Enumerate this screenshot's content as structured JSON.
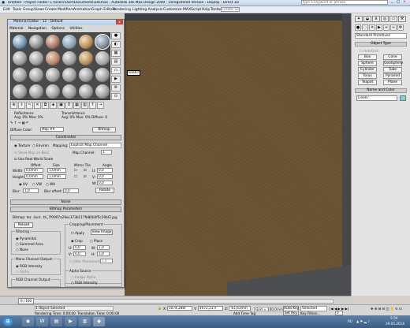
{
  "window": {
    "title": "Untitled     - Project Folder: C:\\Users\\User\\Documents\\3dsmax     - Autodesk 3ds Max Design 2009   - Unregistered Version      - Display : Direct 3D",
    "search_placeholder": "Type a keyword or phrase",
    "selection_set_placeholder": "Create Selection Set"
  },
  "menu": [
    "Edit",
    "Tools",
    "Group",
    "Views",
    "Create",
    "Modifiers",
    "Animation",
    "Graph Editors",
    "Rendering",
    "Lighting Analysis",
    "Customize",
    "MAXScript",
    "Help",
    "Tentacles"
  ],
  "viewport": {
    "object_label": "line07"
  },
  "command_panel": {
    "category_dropdown": "Standard Primitives",
    "object_type_header": "Object Type",
    "autogrid_label": "AutoGrid",
    "buttons": [
      "Box",
      "Cone",
      "Sphere",
      "GeoSphere",
      "Cylinder",
      "Tube",
      "Torus",
      "Pyramid",
      "Teapot",
      "Plane"
    ],
    "name_color_header": "Name and Color",
    "object_name": "Line07"
  },
  "material_editor": {
    "title": "Material Editor - 12 - Default",
    "menu": [
      "Material",
      "Navigation",
      "Options",
      "Utilities"
    ],
    "reflectance": {
      "label": "Reflectance",
      "avg": "Avg:",
      "avg_value": "0%",
      "max": "Max:",
      "max_value": "0%"
    },
    "transmittance": {
      "label": "Transmittance",
      "avg": "Avg:",
      "avg_value": "0%",
      "max": "Max:",
      "max_value": "0%",
      "diffuse": "Diffuse:",
      "diffuse_value": "0"
    },
    "map_label": "Diffuse Color:",
    "map_value": "Map #9",
    "bitmap_type": "Bitmap",
    "coordinates_header": "Coordinates",
    "texture_label": "Texture",
    "environ_label": "Environ",
    "mapping_label": "Mapping:",
    "mapping_value": "Explicit Map Channel",
    "show_map_on_back": "Show Map on Back",
    "map_channel_label": "Map Channel:",
    "map_channel_value": "1",
    "use_real_world_scale": "Use Real-World Scale",
    "col_offset": "Offset",
    "col_size": "Size",
    "col_mirror_tile": "Mirror Tile",
    "col_angle": "Angle",
    "width_label": "Width:",
    "width_offset": "0,0mm",
    "width_size": "1,0mm",
    "height_label": "Height:",
    "height_offset": "0,0mm",
    "height_size": "1,0mm",
    "u_angle_label": "U:",
    "u_angle": "0,0",
    "v_angle_label": "V:",
    "v_angle": "0,0",
    "w_angle_label": "W:",
    "w_angle": "0,0",
    "uv": "UV",
    "vw": "VW",
    "wu": "WU",
    "blur_label": "Blur:",
    "blur_value": "1,0",
    "blur_offset_label": "Blur offset:",
    "blur_offset_value": "0,0",
    "rotate_label": "Rotate",
    "noise_header": "Noise",
    "bitmap_params_header": "Bitmap Parameters",
    "bitmap_path": "Bitmap:  ter...buil...th_7f0907a29ec373b117fb80b0f5c29bf2.jpg",
    "reload_label": "Reload",
    "cropping_header": "Cropping/Placement",
    "apply_label": "Apply",
    "view_image_label": "View Image",
    "crop_label": "Crop",
    "place_label": "Place",
    "crop_u": "0,0",
    "crop_w": "1,0",
    "crop_v": "0,0",
    "crop_h": "1,0",
    "jitter_label": "Jitter Placement:",
    "jitter_value": "1,0",
    "filtering_header": "Filtering",
    "pyramidal": "Pyramidal",
    "summed_area": "Summed Area",
    "none": "None",
    "mono_header": "Mono Channel Output:",
    "rgb_intensity": "RGB Intensity",
    "alpha": "Alpha",
    "rgb_channel_header": "RGB Channel Output:",
    "alpha_source_header": "Alpha Source",
    "image_alpha": "Image Alpha",
    "rgb_intensity2": "RGB Intensity"
  },
  "timeline": {
    "slider": "0 / 100"
  },
  "status": {
    "selected": "1 Object Selected",
    "render_time": "Rendering Time: 0:00:00",
    "translation_time": "Translation Time: 0:00:00",
    "x_label": "X:",
    "x_value": "5074,288r",
    "y_label": "Y:",
    "y_value": "4072,237r",
    "z_label": "Z:",
    "z_value": "-61,63mm",
    "grid": "Grid = 100,0mm",
    "add_time_tag": "Add Time Tag",
    "auto_key": "Auto Key",
    "set_key": "Set Key",
    "key_dropdown": "Selected",
    "key_filters": "Key Filters...",
    "frame_value": "0"
  },
  "taskbar": {
    "language": "RU",
    "time": "5:59",
    "date": "29.05.2014"
  },
  "colors": {
    "viewport": "#6b5233",
    "accent": "#3b5b82",
    "panel": "#d4d0c8"
  }
}
